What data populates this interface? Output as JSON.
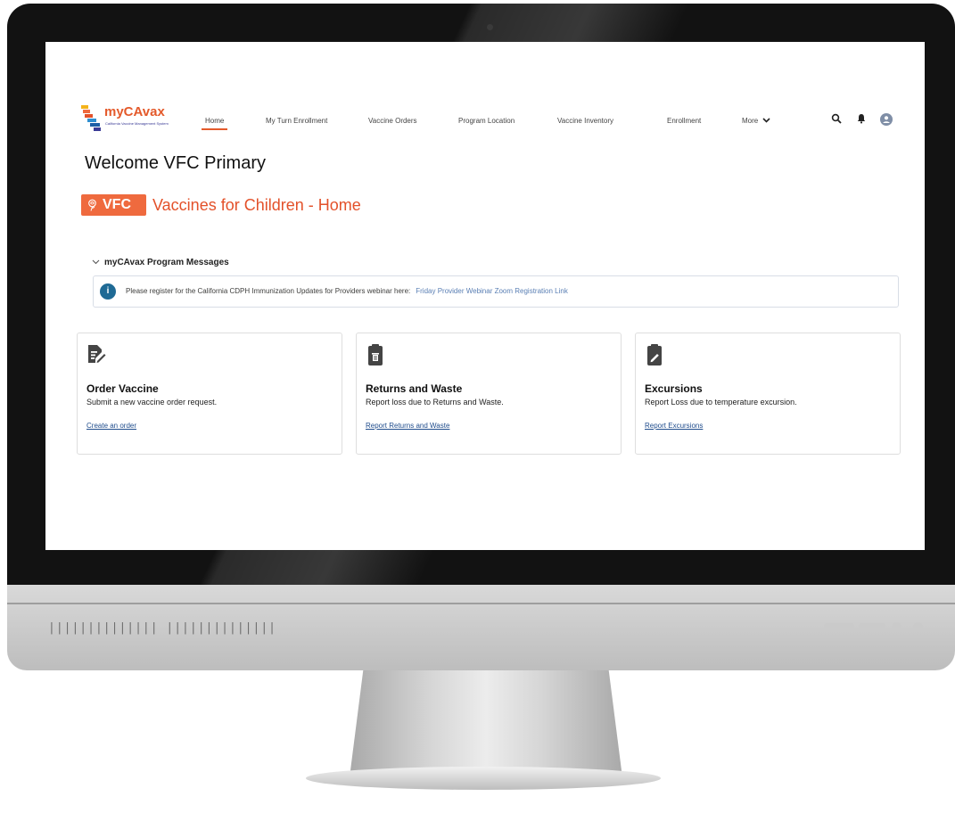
{
  "app": {
    "logo_text": "myCAvax",
    "logo_tagline": "California Vaccine Management System"
  },
  "nav": {
    "items": [
      {
        "label": "Home"
      },
      {
        "label": "My Turn Enrollment"
      },
      {
        "label": "Vaccine Orders"
      },
      {
        "label": "Program Location"
      },
      {
        "label": "Vaccine Inventory"
      },
      {
        "label": "Enrollment"
      },
      {
        "label": "More"
      }
    ],
    "active": "Home",
    "icons": [
      "search-icon",
      "bell-icon",
      "user-avatar-icon"
    ]
  },
  "page": {
    "welcome": "Welcome VFC Primary",
    "badge": "VFC",
    "program_title": "Vaccines for Children - Home"
  },
  "messages": {
    "section_title": "myCAvax Program Messages",
    "text": "Please register for the California CDPH Immunization Updates for Providers webinar here:",
    "link": "Friday Provider Webinar Zoom Registration Link"
  },
  "cards": [
    {
      "title": "Order Vaccine",
      "description": "Submit a new vaccine order request.",
      "link": "Create an order",
      "icon": "order-document-icon"
    },
    {
      "title": "Returns and Waste",
      "description": "Report loss due to Returns and Waste.",
      "link": "Report Returns and Waste",
      "icon": "clipboard-trash-icon"
    },
    {
      "title": "Excursions",
      "description": "Report Loss due to temperature excursion.",
      "link": "Report Excursions",
      "icon": "clipboard-edit-icon"
    }
  ],
  "colors": {
    "accent": "#e3512a",
    "brand_blue": "#3a3b96",
    "link": "#1f4c8c",
    "info": "#1f6a95"
  },
  "device": {
    "grille": "||||||||||||||  ||||||||||||||"
  }
}
